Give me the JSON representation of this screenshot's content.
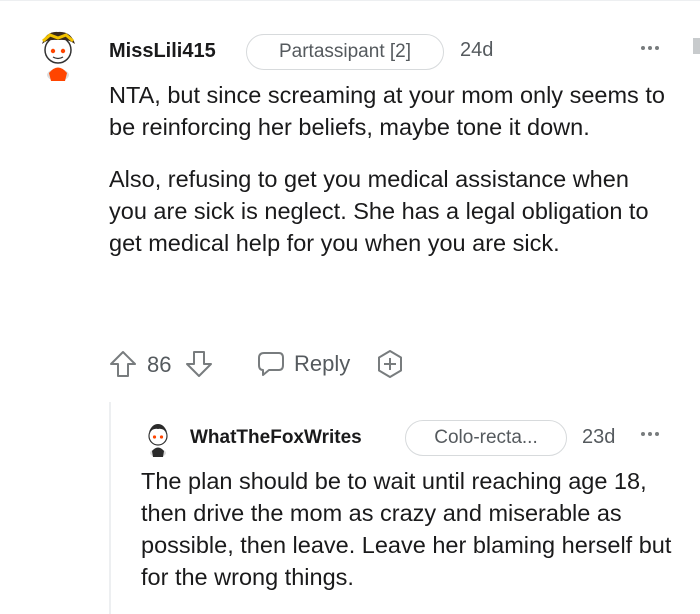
{
  "comments": [
    {
      "username": "MissLili415",
      "flair": "Partassipant [2]",
      "age": "24d",
      "body": [
        "NTA, but since screaming at your mom only seems to be reinforcing her beliefs, maybe tone it down.",
        "Also, refusing to get you medical assistance when you are sick is neglect. She has a legal obligation to get medical help for you when you are sick."
      ],
      "score": "86",
      "reply_label": "Reply"
    },
    {
      "username": "WhatTheFoxWrites",
      "flair": "Colo-recta...",
      "age": "23d",
      "body": [
        "The plan should be to wait until reaching age 18, then drive the mom as crazy and miserable as possible, then leave. Leave her blaming herself but for the wrong things."
      ]
    }
  ],
  "icons": {
    "upvote": "arrow-up-icon",
    "downvote": "arrow-down-icon",
    "reply": "speech-bubble-icon",
    "award": "award-plus-icon",
    "more": "more-dots-icon"
  },
  "colors": {
    "text": "#1a1a1b",
    "meta": "#555a5e",
    "border": "#d7dadc",
    "avatar_orange": "#ff4500"
  }
}
